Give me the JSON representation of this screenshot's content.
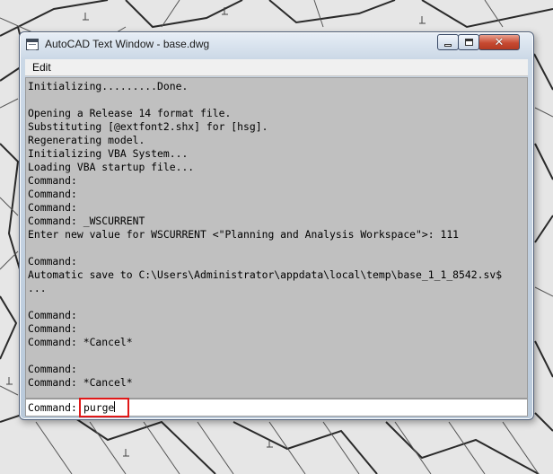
{
  "window": {
    "title": "AutoCAD Text Window - base.dwg",
    "controls": {
      "minimize": "minimize",
      "maximize": "maximize",
      "close": "✕"
    }
  },
  "menu": {
    "items": [
      {
        "label": "Edit"
      }
    ]
  },
  "log": {
    "lines": [
      "Initializing.........Done.",
      "",
      "Opening a Release 14 format file.",
      "Substituting [@extfont2.shx] for [hsg].",
      "Regenerating model.",
      "Initializing VBA System...",
      "Loading VBA startup file...",
      "Command:",
      "Command:",
      "Command:",
      "Command: _WSCURRENT",
      "Enter new value for WSCURRENT <\"Planning and Analysis Workspace\">: 111",
      "",
      "Command:",
      "Automatic save to C:\\Users\\Administrator\\appdata\\local\\temp\\base_1_1_8542.sv$",
      "...",
      "",
      "Command:",
      "Command:",
      "Command: *Cancel*",
      "",
      "Command:",
      "Command: *Cancel*"
    ]
  },
  "command_line": {
    "prompt": "Command:",
    "value": "purge"
  },
  "colors": {
    "highlight": "#e01818",
    "text_area_bg": "#c0c0c0"
  }
}
